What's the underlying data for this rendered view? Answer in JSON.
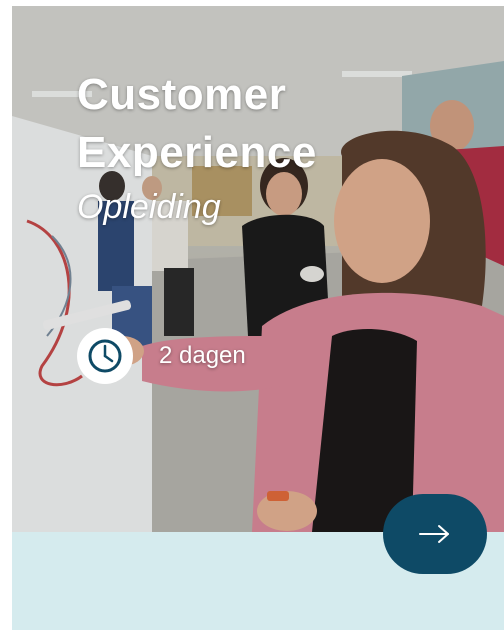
{
  "card": {
    "title_line1": "Customer",
    "title_line2": "Experience",
    "subtitle": "Opleiding",
    "duration": "2 dagen",
    "icons": {
      "duration": "clock-icon",
      "next": "arrow-right-icon"
    },
    "colors": {
      "panel": "#d5ebee",
      "button": "#0e4a66",
      "text": "#ffffff"
    }
  }
}
